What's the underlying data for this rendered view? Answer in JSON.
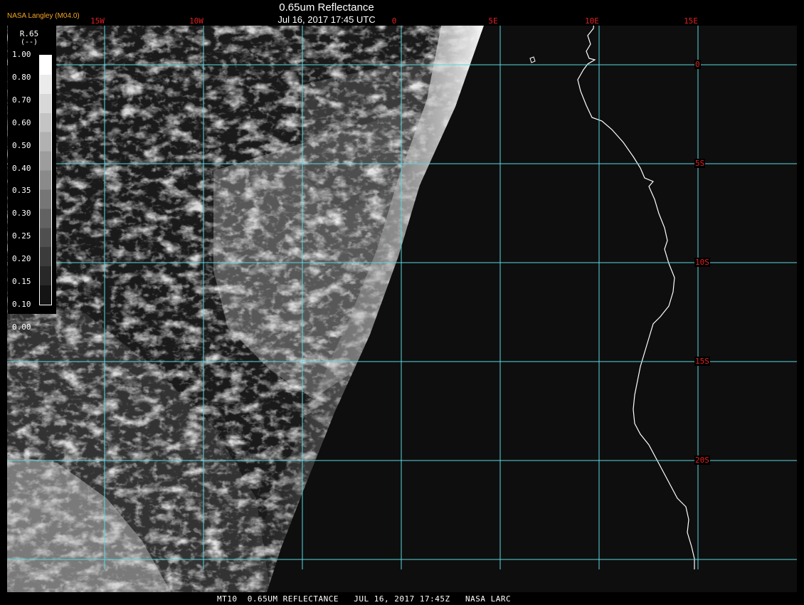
{
  "header": {
    "title": "0.65um Reflectance",
    "subtitle": "Jul 16, 2017 17:45 UTC",
    "credit": "NASA Langley (M04.0)"
  },
  "grid": {
    "longitudes": [
      {
        "label": "15W",
        "value": -15
      },
      {
        "label": "10W",
        "value": -10
      },
      {
        "label": "0",
        "value": 0
      },
      {
        "label": "5E",
        "value": 5
      },
      {
        "label": "10E",
        "value": 10
      },
      {
        "label": "15E",
        "value": 15
      }
    ],
    "latitudes": [
      {
        "label": "0",
        "value": 0
      },
      {
        "label": "5S",
        "value": -5
      },
      {
        "label": "10S",
        "value": -10
      },
      {
        "label": "15S",
        "value": -15
      },
      {
        "label": "20S",
        "value": -20
      }
    ],
    "line_color": "#5ad8e0",
    "label_color": "#e02020"
  },
  "legend": {
    "title": "R.65",
    "unit": "(--)",
    "ticks": [
      "1.00",
      "0.80",
      "0.70",
      "0.60",
      "0.50",
      "0.40",
      "0.35",
      "0.30",
      "0.25",
      "0.20",
      "0.15",
      "0.10",
      "0.00"
    ]
  },
  "footer": {
    "text": "MT10  0.65UM REFLECTANCE   JUL 16, 2017 17:45Z   NASA LARC"
  },
  "colors": {
    "background": "#000000",
    "ocean_dark": "#111111",
    "coastline": "#ffffff",
    "cloud_light": "#d8d8d8"
  }
}
